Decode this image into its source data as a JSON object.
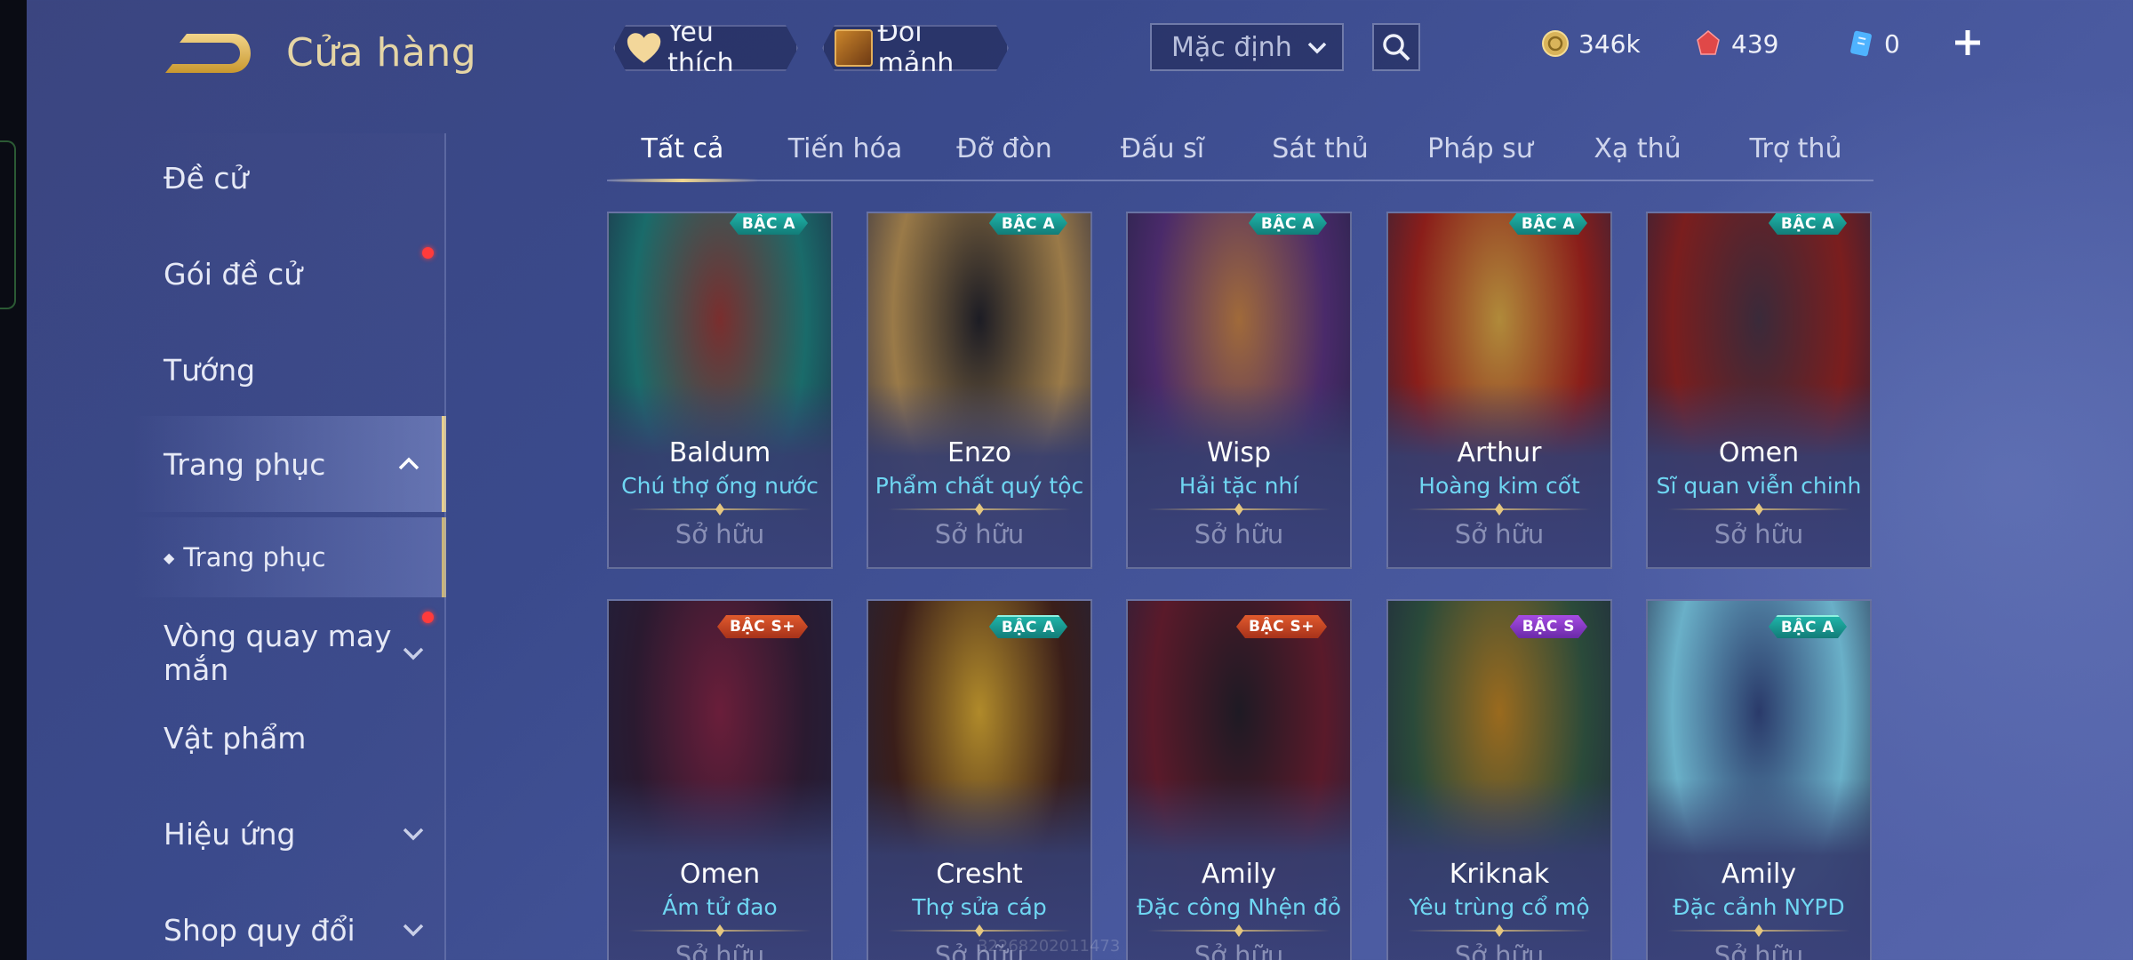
{
  "header": {
    "title": "Cửa hàng",
    "back_icon": "back-arrow-icon",
    "favorite_label": "Yêu thích",
    "fragment_label": "Đổi mảnh",
    "sort_value": "Mặc định",
    "search_icon": "search-icon"
  },
  "currency": [
    {
      "icon": "gold-coin-icon",
      "value": "346k",
      "color": "#d9b45a"
    },
    {
      "icon": "ruby-gem-icon",
      "value": "439",
      "color": "#e04848"
    },
    {
      "icon": "voucher-icon",
      "value": "0",
      "color": "#4fb3ff"
    }
  ],
  "sidebar": {
    "items": [
      {
        "label": "Đề cử"
      },
      {
        "label": "Gói đề cử",
        "badge": true
      },
      {
        "label": "Tướng"
      },
      {
        "label": "Trang phục",
        "active": true,
        "expanded": true
      },
      {
        "label": "Trang phục",
        "sub": true
      },
      {
        "label": "Vòng quay may mắn",
        "badge": true,
        "collapsible": true
      },
      {
        "label": "Vật phẩm"
      },
      {
        "label": "Hiệu ứng",
        "collapsible": true
      },
      {
        "label": "Shop quy đổi",
        "collapsible": true
      }
    ]
  },
  "tabs": [
    "Tất cả",
    "Tiến hóa",
    "Đỡ đòn",
    "Đấu sĩ",
    "Sát thủ",
    "Pháp sư",
    "Xạ thủ",
    "Trợ thủ"
  ],
  "active_tab": "Tất cả",
  "cards": [
    {
      "hero": "Baldum",
      "skin": "Chú thợ ống nước",
      "tier": "BẬC A",
      "tier_class": "a",
      "status": "Sở hữu",
      "art": [
        "#1a6b6a",
        "#7a2e2e"
      ]
    },
    {
      "hero": "Enzo",
      "skin": "Phẩm chất quý tộc",
      "tier": "BẬC A",
      "tier_class": "a",
      "status": "Sở hữu",
      "art": [
        "#9a7a48",
        "#1c1c24"
      ]
    },
    {
      "hero": "Wisp",
      "skin": "Hải tặc nhí",
      "tier": "BẬC A",
      "tier_class": "a",
      "status": "Sở hữu",
      "art": [
        "#4a2a6a",
        "#a06a3a"
      ]
    },
    {
      "hero": "Arthur",
      "skin": "Hoàng kim cốt",
      "tier": "BẬC A",
      "tier_class": "a",
      "status": "Sở hữu",
      "art": [
        "#8a1e1a",
        "#b08a3a"
      ]
    },
    {
      "hero": "Omen",
      "skin": "Sĩ quan viễn chinh",
      "tier": "BẬC A",
      "tier_class": "a",
      "status": "Sở hữu",
      "art": [
        "#7a1e1e",
        "#3a2a3a"
      ]
    },
    {
      "hero": "Omen",
      "skin": "Ám tử đao",
      "tier": "BẬC S+",
      "tier_class": "sp",
      "status": "Sở hữu",
      "art": [
        "#2a1a30",
        "#6a1e3a"
      ]
    },
    {
      "hero": "Cresht",
      "skin": "Thợ sửa cáp",
      "tier": "BẬC A",
      "tier_class": "a",
      "status": "Sở hữu",
      "art": [
        "#3a1e1a",
        "#b08a2a"
      ]
    },
    {
      "hero": "Amily",
      "skin": "Đặc công Nhện đỏ",
      "tier": "BẬC S+",
      "tier_class": "sp",
      "status": "Sở hữu",
      "art": [
        "#5a1a2a",
        "#1e1a24"
      ]
    },
    {
      "hero": "Kriknak",
      "skin": "Yêu trùng cổ mộ",
      "tier": "BẬC S",
      "tier_class": "s",
      "status": "Sở hữu",
      "art": [
        "#2a4a3a",
        "#9a6a1e"
      ]
    },
    {
      "hero": "Amily",
      "skin": "Đặc cảnh NYPD",
      "tier": "BẬC A",
      "tier_class": "a",
      "status": "Sở hữu",
      "art": [
        "#6ab0c8",
        "#2a3a6a"
      ]
    }
  ],
  "watermark": "32268202011473"
}
